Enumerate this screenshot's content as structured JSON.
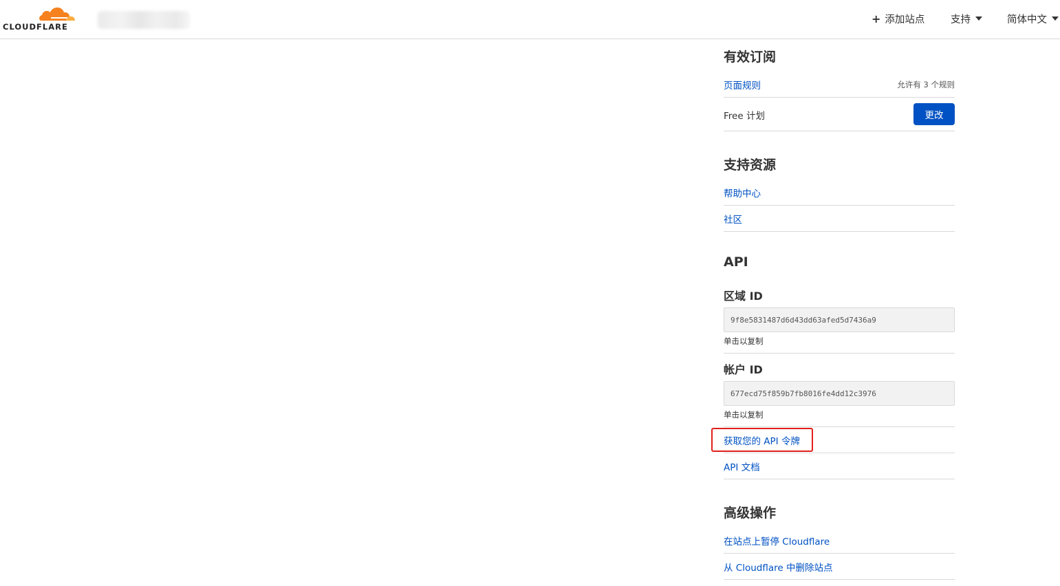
{
  "header": {
    "logo_text": "CLOUDFLARE",
    "nav": {
      "add_site": "添加站点",
      "support": "支持",
      "language": "简体中文"
    }
  },
  "subscriptions": {
    "title": "有效订阅",
    "page_rules_link": "页面规则",
    "page_rules_allowance": "允许有 3 个规则",
    "plan": "Free 计划",
    "change_button": "更改"
  },
  "support_resources": {
    "title": "支持资源",
    "help_center": "帮助中心",
    "community": "社区"
  },
  "api": {
    "title": "API",
    "zone_id_label": "区域 ID",
    "zone_id_value": "9f8e5831487d6d43dd63afed5d7436a9",
    "zone_id_hint": "单击以复制",
    "account_id_label": "帐户 ID",
    "account_id_value": "677ecd75f859b7fb8016fe4dd12c3976",
    "account_id_hint": "单击以复制",
    "get_token_link": "获取您的 API 令牌",
    "docs_link": "API 文档"
  },
  "advanced": {
    "title": "高级操作",
    "pause_link": "在站点上暂停 Cloudflare",
    "remove_link": "从 Cloudflare 中删除站点"
  },
  "colors": {
    "brand_orange": "#f6821f",
    "link_blue": "#0051c3",
    "highlight_red": "#e0201b"
  }
}
